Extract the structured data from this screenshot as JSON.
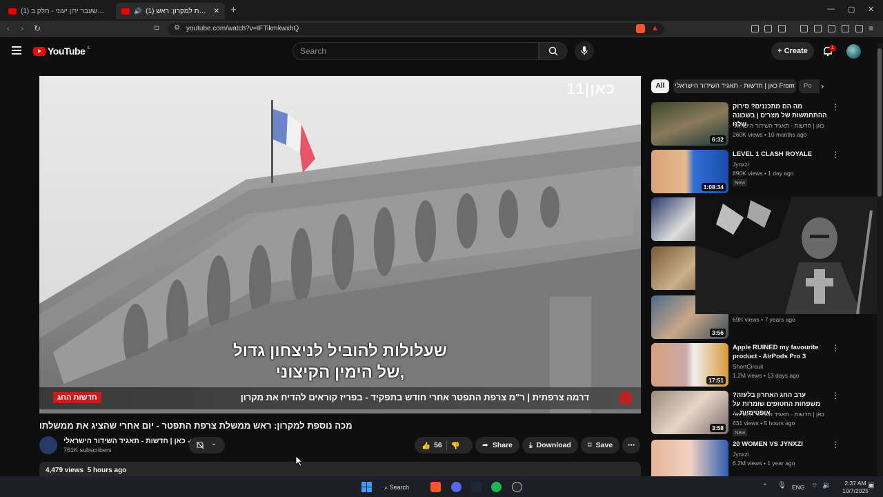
{
  "browser": {
    "tabs": [
      {
        "label": "(1) הרב לשעבר ירון יעוני - חלק ב"
      },
      {
        "label": "(1) מכה נוספת למקרון: ראש"
      }
    ],
    "url": "youtube.com/watch?v=IFTikmkwxhQ"
  },
  "header": {
    "logo_text": "YouTube",
    "country_code": "IL",
    "search_placeholder": "Search",
    "create_label": "Create",
    "notification_count": "1"
  },
  "video": {
    "subtitle_line1": "שעלולות להוביל לניצחון גדול",
    "subtitle_line2": "של הימין הקיצוני,",
    "ticker_badge": "חדשות החג",
    "ticker_text": "דרמה צרפתית | ר\"מ צרפת התפטר אחרי חודש בתפקיד - בפריז קוראים להדיח את מקרון",
    "watermark": "כאן|11"
  },
  "meta": {
    "title": "מכה נוספת למקרון: ראש ממשלת צרפת התפטר - יום אחרי שהציג את ממשלתו",
    "channel_name": "כאן | חדשות - תאגיד השידור הישראלי",
    "subscribers": "761K subscribers",
    "likes": "56",
    "share_label": "Share",
    "download_label": "Download",
    "save_label": "Save",
    "views": "4,479 views",
    "published": "5 hours ago"
  },
  "sidebar": {
    "chips": [
      "All",
      "כאן | חדשות - תאגיד השידור הישראלי From",
      "Po"
    ],
    "items": [
      {
        "title": "מה הם מתכננים? סירוק ההתחמשות של מצרים | בשכונה שלנו",
        "channel": "כאן | חדשות - תאגיד השידור הישראלי",
        "meta": "260K views • 10 months ago",
        "duration": "6:32",
        "is_new": ""
      },
      {
        "title": "LEVEL 1 CLASH ROYALE",
        "channel": "Jynxzi",
        "meta": "890K views • 1 day ago",
        "duration": "1:08:34",
        "is_new": "New"
      },
      {
        "title": "",
        "channel": "",
        "meta": "",
        "duration": "",
        "is_new": ""
      },
      {
        "title": "",
        "channel": "",
        "meta": "",
        "duration": "",
        "is_new": ""
      },
      {
        "title": "",
        "channel": "",
        "meta": "69K views • 7 years ago",
        "duration": "3:56",
        "is_new": ""
      },
      {
        "title": "Apple RUINED my favourite product - AirPods Pro 3",
        "channel": "ShortCircuit",
        "meta": "1.2M views • 13 days ago",
        "duration": "17:51",
        "is_new": ""
      },
      {
        "title": "ערב החג האחרון בלעזה? משפחות החטופים שומרות על אופטימיות ...",
        "channel": "כאן | חדשות - תאגיד השידור הישראלי",
        "meta": "631 views • 5 hours ago",
        "duration": "3:58",
        "is_new": "New"
      },
      {
        "title": "20 WOMEN VS JYNXZI",
        "channel": "Jynxzi",
        "meta": "6.2M views • 1 year ago",
        "duration": "",
        "is_new": ""
      }
    ]
  },
  "taskbar": {
    "search_label": "Search",
    "lang": "ENG",
    "time": "2:37 AM",
    "date": "10/7/2025"
  },
  "colors": {
    "background": "#0f0f0f",
    "yt_red": "#ff0000",
    "ticker_red": "#cc1b1b"
  }
}
